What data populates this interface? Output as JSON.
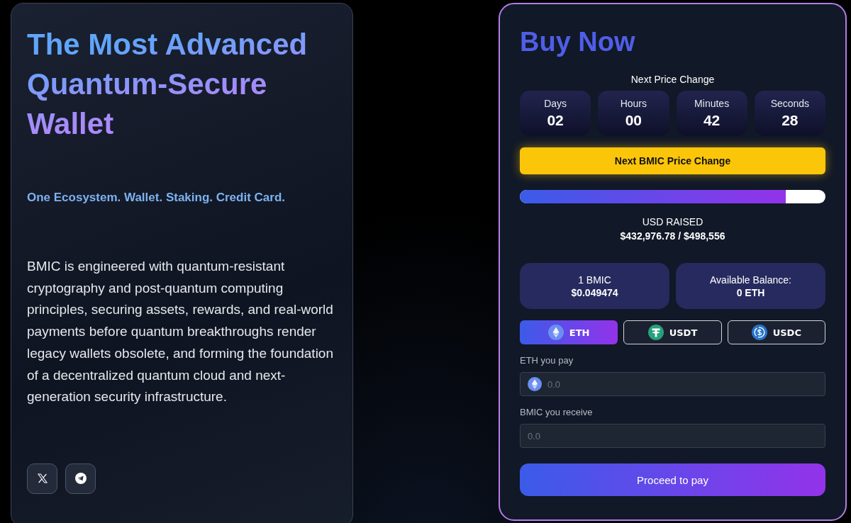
{
  "hero": {
    "title": "The Most Advanced Quantum-Secure Wallet",
    "tagline": "One Ecosystem. Wallet. Staking. Credit Card.",
    "description": "BMIC is engineered with quantum-resistant cryptography and post-quantum computing principles, securing assets, rewards, and real-world payments before quantum breakthroughs render legacy wallets obsolete, and forming the foundation of a decentralized quantum cloud and next-generation security infrastructure.",
    "socials": [
      {
        "kind": "x"
      },
      {
        "kind": "telegram"
      }
    ]
  },
  "buy": {
    "title": "Buy Now",
    "countdown_label": "Next Price Change",
    "countdown": [
      {
        "unit": "Days",
        "value": "02"
      },
      {
        "unit": "Hours",
        "value": "00"
      },
      {
        "unit": "Minutes",
        "value": "42"
      },
      {
        "unit": "Seconds",
        "value": "28"
      }
    ],
    "price_banner": "Next BMIC Price Change",
    "progress": {
      "level": 0.87
    },
    "raised_label": "USD RAISED",
    "raised_value": "$432,976.78 / $498,556",
    "stats": [
      {
        "label": "1 BMIC",
        "value": "$0.049474"
      },
      {
        "label": "Available Balance:",
        "value": "0 ETH"
      }
    ],
    "currencies": [
      {
        "kind": "eth",
        "label": "ETH",
        "selected": true
      },
      {
        "kind": "usdt",
        "label": "USDT",
        "selected": false
      },
      {
        "kind": "usdc",
        "label": "USDC",
        "selected": false
      }
    ],
    "fields": [
      {
        "label": "ETH you pay",
        "placeholder": "0.0",
        "kind": "eth"
      },
      {
        "label": "BMIC you receive",
        "placeholder": "0.0",
        "kind": "plain"
      }
    ],
    "submit": "Proceed to pay"
  }
}
